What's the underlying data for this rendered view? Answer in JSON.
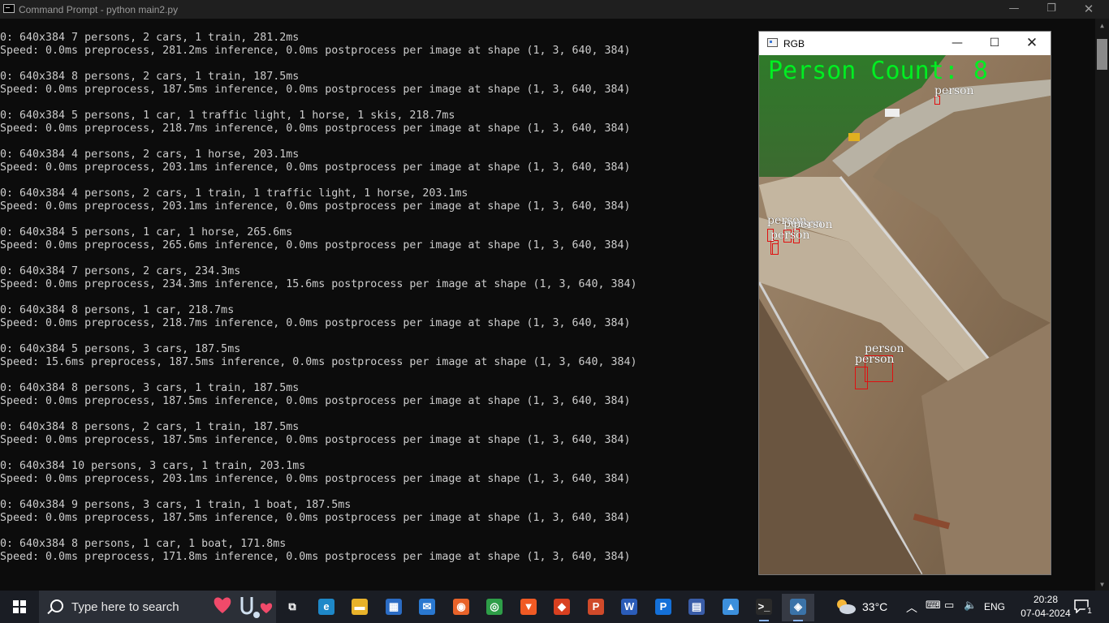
{
  "cmd": {
    "title": "Command Prompt - python  main2.py",
    "minimize": "—",
    "maximize": "❐",
    "close": "✕"
  },
  "console": {
    "blocks": [
      {
        "line1": "0: 640x384 7 persons, 2 cars, 1 train, 281.2ms",
        "line2": "Speed: 0.0ms preprocess, 281.2ms inference, 0.0ms postprocess per image at shape (1, 3, 640, 384)"
      },
      {
        "line1": "0: 640x384 8 persons, 2 cars, 1 train, 187.5ms",
        "line2": "Speed: 0.0ms preprocess, 187.5ms inference, 0.0ms postprocess per image at shape (1, 3, 640, 384)"
      },
      {
        "line1": "0: 640x384 5 persons, 1 car, 1 traffic light, 1 horse, 1 skis, 218.7ms",
        "line2": "Speed: 0.0ms preprocess, 218.7ms inference, 0.0ms postprocess per image at shape (1, 3, 640, 384)"
      },
      {
        "line1": "0: 640x384 4 persons, 2 cars, 1 horse, 203.1ms",
        "line2": "Speed: 0.0ms preprocess, 203.1ms inference, 0.0ms postprocess per image at shape (1, 3, 640, 384)"
      },
      {
        "line1": "0: 640x384 4 persons, 2 cars, 1 train, 1 traffic light, 1 horse, 203.1ms",
        "line2": "Speed: 0.0ms preprocess, 203.1ms inference, 0.0ms postprocess per image at shape (1, 3, 640, 384)"
      },
      {
        "line1": "0: 640x384 5 persons, 1 car, 1 horse, 265.6ms",
        "line2": "Speed: 0.0ms preprocess, 265.6ms inference, 0.0ms postprocess per image at shape (1, 3, 640, 384)"
      },
      {
        "line1": "0: 640x384 7 persons, 2 cars, 234.3ms",
        "line2": "Speed: 0.0ms preprocess, 234.3ms inference, 15.6ms postprocess per image at shape (1, 3, 640, 384)"
      },
      {
        "line1": "0: 640x384 8 persons, 1 car, 218.7ms",
        "line2": "Speed: 0.0ms preprocess, 218.7ms inference, 0.0ms postprocess per image at shape (1, 3, 640, 384)"
      },
      {
        "line1": "0: 640x384 5 persons, 3 cars, 187.5ms",
        "line2": "Speed: 15.6ms preprocess, 187.5ms inference, 0.0ms postprocess per image at shape (1, 3, 640, 384)"
      },
      {
        "line1": "0: 640x384 8 persons, 3 cars, 1 train, 187.5ms",
        "line2": "Speed: 0.0ms preprocess, 187.5ms inference, 0.0ms postprocess per image at shape (1, 3, 640, 384)"
      },
      {
        "line1": "0: 640x384 8 persons, 2 cars, 1 train, 187.5ms",
        "line2": "Speed: 0.0ms preprocess, 187.5ms inference, 0.0ms postprocess per image at shape (1, 3, 640, 384)"
      },
      {
        "line1": "0: 640x384 10 persons, 3 cars, 1 train, 203.1ms",
        "line2": "Speed: 0.0ms preprocess, 203.1ms inference, 0.0ms postprocess per image at shape (1, 3, 640, 384)"
      },
      {
        "line1": "0: 640x384 9 persons, 3 cars, 1 train, 1 boat, 187.5ms",
        "line2": "Speed: 0.0ms preprocess, 187.5ms inference, 0.0ms postprocess per image at shape (1, 3, 640, 384)"
      },
      {
        "line1": "0: 640x384 8 persons, 1 car, 1 boat, 171.8ms",
        "line2": "Speed: 0.0ms preprocess, 171.8ms inference, 0.0ms postprocess per image at shape (1, 3, 640, 384)"
      }
    ]
  },
  "rgb_window": {
    "title": "RGB",
    "minimize": "—",
    "maximize": "☐",
    "close": "✕",
    "person_count_text": "Person Count: 8",
    "detections": [
      {
        "label": "person"
      },
      {
        "label": "person"
      },
      {
        "label": "person"
      },
      {
        "label": "person"
      },
      {
        "label": "person"
      },
      {
        "label": "person"
      },
      {
        "label": "person"
      },
      {
        "label": "person"
      }
    ]
  },
  "taskbar": {
    "search_placeholder": "Type here to search",
    "apps": [
      {
        "name": "task-view",
        "glyph": "⧉",
        "color": "#1a1d24"
      },
      {
        "name": "edge",
        "glyph": "e",
        "color": "#1e88c8"
      },
      {
        "name": "file-explorer",
        "glyph": "▬",
        "color": "#e8b22a"
      },
      {
        "name": "microsoft-store",
        "glyph": "▦",
        "color": "#2b6cc4"
      },
      {
        "name": "mail",
        "glyph": "✉",
        "color": "#2a78d0"
      },
      {
        "name": "firefox",
        "glyph": "◉",
        "color": "#e8632a"
      },
      {
        "name": "chrome",
        "glyph": "◎",
        "color": "#2e9e48"
      },
      {
        "name": "brave",
        "glyph": "▼",
        "color": "#f05a24"
      },
      {
        "name": "brave-alt",
        "glyph": "◆",
        "color": "#d84020"
      },
      {
        "name": "powerpoint",
        "glyph": "P",
        "color": "#d04a2a"
      },
      {
        "name": "word",
        "glyph": "W",
        "color": "#2b5cb8"
      },
      {
        "name": "app-p",
        "glyph": "P",
        "color": "#1470d8"
      },
      {
        "name": "document-app",
        "glyph": "▤",
        "color": "#3a5da8"
      },
      {
        "name": "photos",
        "glyph": "▲",
        "color": "#3c8fdc"
      },
      {
        "name": "terminal",
        "glyph": ">_",
        "color": "#2a2a2a"
      },
      {
        "name": "python",
        "glyph": "◈",
        "color": "#3b73a8"
      }
    ],
    "temperature": "33°C",
    "chevron": "︿",
    "language": "ENG",
    "time": "20:28",
    "date": "07-04-2024",
    "notification_count": "1"
  }
}
